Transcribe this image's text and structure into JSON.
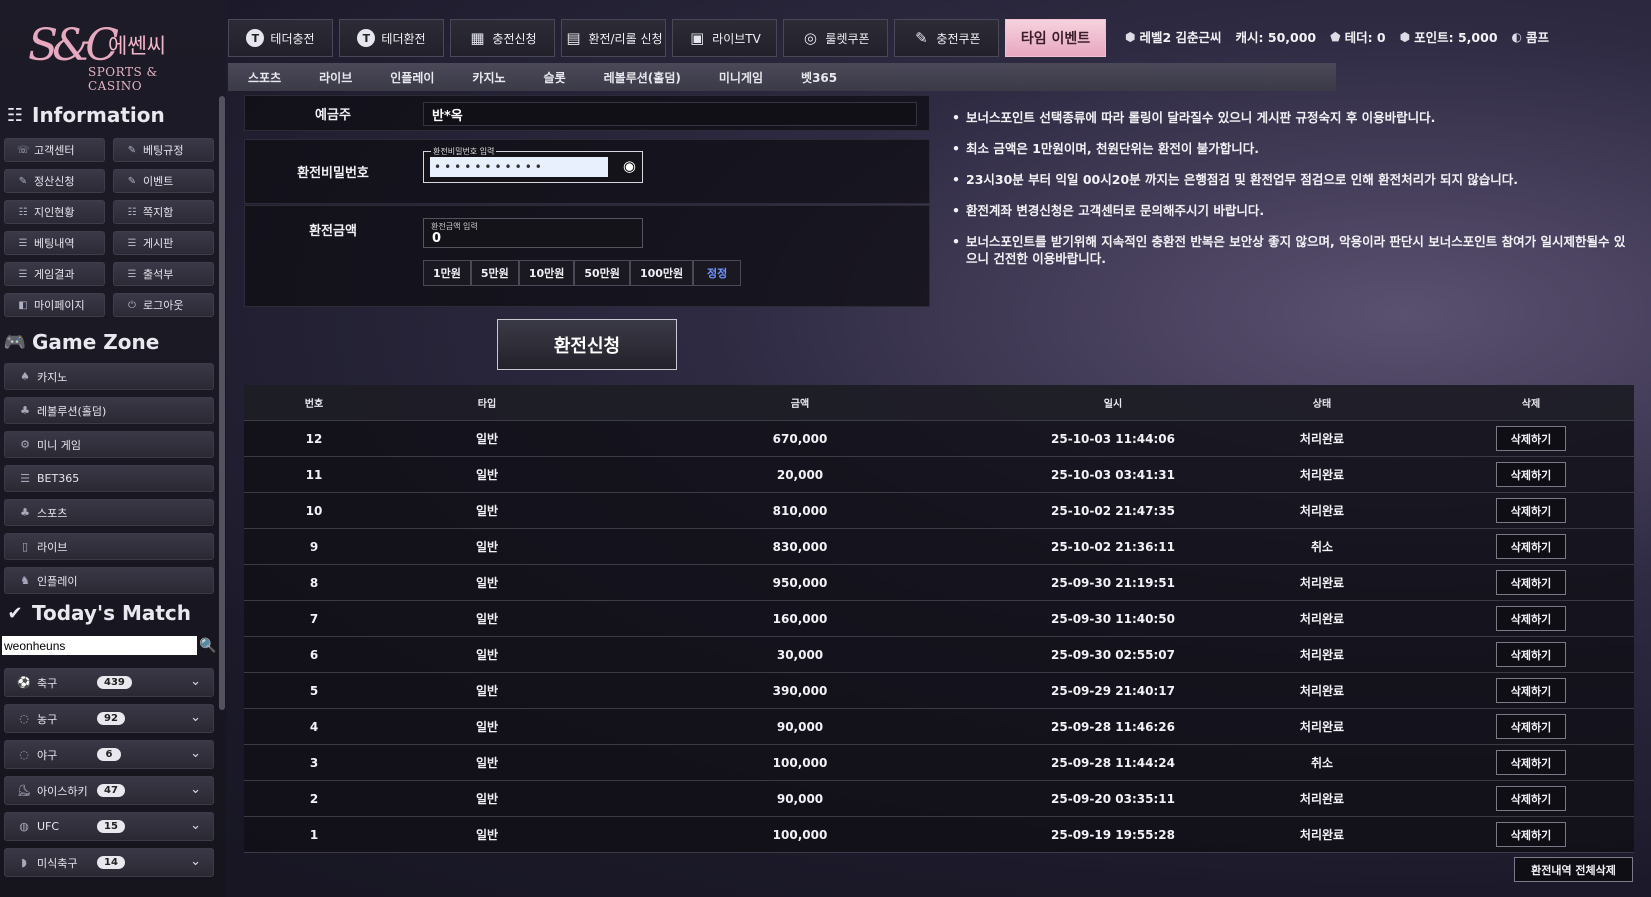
{
  "logo": {
    "mark": "S&C",
    "korean": "에쎈씨",
    "english": "SPORTS & CASINO"
  },
  "topnav": [
    {
      "label": "테더충전",
      "icon": "T"
    },
    {
      "label": "테더환전",
      "icon": "T"
    },
    {
      "label": "충전신청",
      "icon": "▦"
    },
    {
      "label": "환전/리롤 신청",
      "icon": "▤"
    },
    {
      "label": "라이브TV",
      "icon": "▣"
    },
    {
      "label": "룰렛쿠폰",
      "icon": "◎"
    },
    {
      "label": "충전쿠폰",
      "icon": "✎"
    }
  ],
  "event_button": "타임 이벤트",
  "user": {
    "level": "레벨2 김춘근씨",
    "cash": "캐시: 50,000",
    "tether": "테더: 0",
    "point": "포인트: 5,000",
    "comp": "콤프"
  },
  "subnav": [
    "스포츠",
    "라이브",
    "인플레이",
    "카지노",
    "슬롯",
    "레볼루션(홀덤)",
    "미니게임",
    "벳365"
  ],
  "info": {
    "title": "Information",
    "items": [
      {
        "label": "고객센터",
        "icon": "☏"
      },
      {
        "label": "베팅규정",
        "icon": "✎"
      },
      {
        "label": "정산신청",
        "icon": "✎"
      },
      {
        "label": "이벤트",
        "icon": "✎"
      },
      {
        "label": "지인현황",
        "icon": "☷"
      },
      {
        "label": "쪽지함",
        "icon": "☷"
      },
      {
        "label": "베팅내역",
        "icon": "☰"
      },
      {
        "label": "게시판",
        "icon": "☰"
      },
      {
        "label": "게임결과",
        "icon": "☰"
      },
      {
        "label": "출석부",
        "icon": "☰"
      },
      {
        "label": "마이페이지",
        "icon": "◧"
      },
      {
        "label": "로그아웃",
        "icon": "⏻"
      }
    ]
  },
  "gamezone": {
    "title": "Game Zone",
    "items": [
      {
        "label": "카지노",
        "icon": "♠"
      },
      {
        "label": "레볼루션(홀덤)",
        "icon": "♣"
      },
      {
        "label": "미니 게임",
        "icon": "⚙"
      },
      {
        "label": "BET365",
        "icon": "☰"
      },
      {
        "label": "스포츠",
        "icon": "♣"
      },
      {
        "label": "라이브",
        "icon": "▯"
      },
      {
        "label": "인플레이",
        "icon": "♞"
      }
    ]
  },
  "todays_match": {
    "title": "Today's Match",
    "search_value": "weonheuns",
    "sports": [
      {
        "label": "축구",
        "count": "439",
        "icon": "⚽"
      },
      {
        "label": "농구",
        "count": "92",
        "icon": "◌"
      },
      {
        "label": "야구",
        "count": "6",
        "icon": "◌"
      },
      {
        "label": "아이스하키",
        "count": "47",
        "icon": "⛸"
      },
      {
        "label": "UFC",
        "count": "15",
        "icon": "◍"
      },
      {
        "label": "미식축구",
        "count": "14",
        "icon": "◗"
      }
    ]
  },
  "form": {
    "depositor_label": "예금주",
    "depositor_value": "반*옥",
    "password_label": "환전비밀번호",
    "password_placeholder": "환전비밀번호 입력",
    "password_value": "•••••••••••",
    "amount_label": "환전금액",
    "amount_placeholder": "환전금액 입력",
    "amount_value": "0",
    "quick_amounts": [
      "1만원",
      "5만원",
      "10만원",
      "50만원",
      "100만원"
    ],
    "reset_label": "정정",
    "submit_label": "환전신청"
  },
  "notices": [
    "보너스포인트 선택종류에 따라 롤링이 달라질수 있으니 게시판 규정숙지 후 이용바랍니다.",
    "최소 금액은 1만원이며, 천원단위는 환전이 불가합니다.",
    "23시30분 부터 익일 00시20분 까지는 은행점검 및 환전업무 점검으로 인해 환전처리가 되지 않습니다.",
    "환전계좌 변경신청은 고객센터로 문의해주시기 바랍니다.",
    "보너스포인트를 받기위해 지속적인 충환전 반복은 보안상 좋지 않으며, 악용이라 판단시 보너스포인트 참여가 일시제한될수 있으니 건전한 이용바랍니다."
  ],
  "table": {
    "headers": [
      "번호",
      "타입",
      "금액",
      "일시",
      "상태",
      "삭제"
    ],
    "delete_label": "삭제하기",
    "rows": [
      {
        "no": "12",
        "type": "일반",
        "amount": "670,000",
        "datetime": "25-10-03 11:44:06",
        "status": "처리완료"
      },
      {
        "no": "11",
        "type": "일반",
        "amount": "20,000",
        "datetime": "25-10-03 03:41:31",
        "status": "처리완료"
      },
      {
        "no": "10",
        "type": "일반",
        "amount": "810,000",
        "datetime": "25-10-02 21:47:35",
        "status": "처리완료"
      },
      {
        "no": "9",
        "type": "일반",
        "amount": "830,000",
        "datetime": "25-10-02 21:36:11",
        "status": "취소"
      },
      {
        "no": "8",
        "type": "일반",
        "amount": "950,000",
        "datetime": "25-09-30 21:19:51",
        "status": "처리완료"
      },
      {
        "no": "7",
        "type": "일반",
        "amount": "160,000",
        "datetime": "25-09-30 11:40:50",
        "status": "처리완료"
      },
      {
        "no": "6",
        "type": "일반",
        "amount": "30,000",
        "datetime": "25-09-30 02:55:07",
        "status": "처리완료"
      },
      {
        "no": "5",
        "type": "일반",
        "amount": "390,000",
        "datetime": "25-09-29 21:40:17",
        "status": "처리완료"
      },
      {
        "no": "4",
        "type": "일반",
        "amount": "90,000",
        "datetime": "25-09-28 11:46:26",
        "status": "처리완료"
      },
      {
        "no": "3",
        "type": "일반",
        "amount": "100,000",
        "datetime": "25-09-28 11:44:24",
        "status": "취소"
      },
      {
        "no": "2",
        "type": "일반",
        "amount": "90,000",
        "datetime": "25-09-20 03:35:11",
        "status": "처리완료"
      },
      {
        "no": "1",
        "type": "일반",
        "amount": "100,000",
        "datetime": "25-09-19 19:55:28",
        "status": "처리완료"
      }
    ],
    "delete_all_label": "환전내역 전체삭제"
  }
}
